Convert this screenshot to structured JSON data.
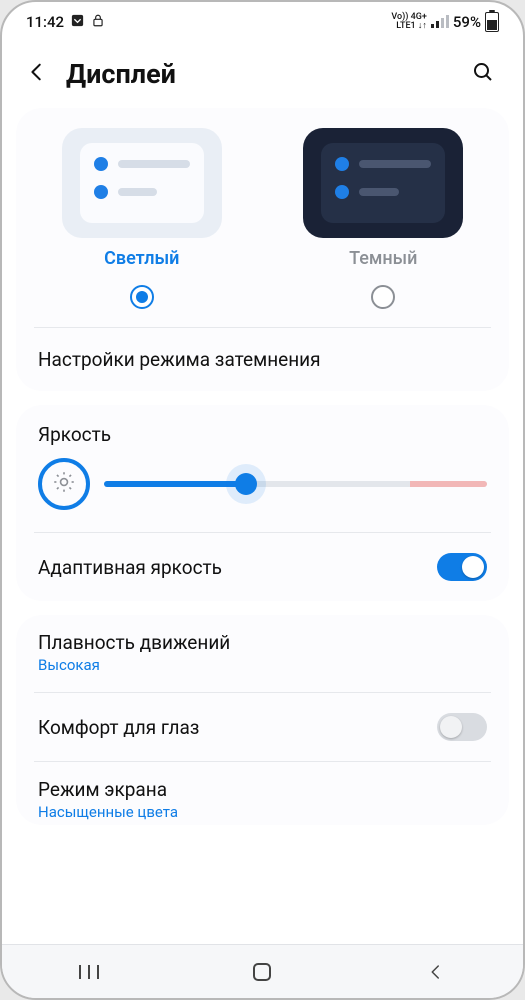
{
  "status": {
    "time": "11:42",
    "net_top": "Vo)) 4G+",
    "net_bottom": "LTE1 ↓↑",
    "battery_pct": "59%"
  },
  "header": {
    "title": "Дисплей"
  },
  "theme": {
    "light_label": "Светлый",
    "dark_label": "Темный",
    "selected": "light",
    "darkening_settings": "Настройки режима затемнения"
  },
  "brightness": {
    "label": "Яркость",
    "value_pct": 37,
    "adaptive_label": "Адаптивная яркость",
    "adaptive_on": true
  },
  "motion": {
    "label": "Плавность движений",
    "value": "Высокая"
  },
  "eye_comfort": {
    "label": "Комфорт для глаз",
    "on": false
  },
  "screen_mode": {
    "label": "Режим экрана",
    "value": "Насыщенные цвета"
  }
}
